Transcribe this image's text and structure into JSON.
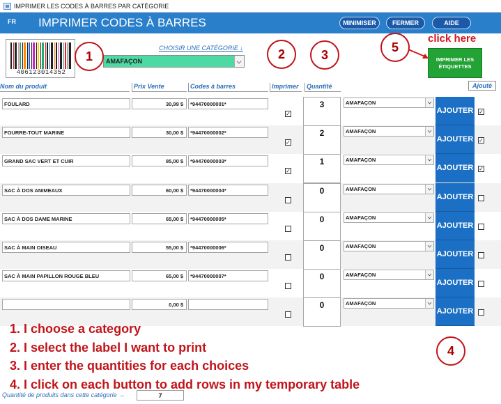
{
  "window": {
    "title": "IMPRIMER LES CODES À BARRES PAR CATÉGORIE"
  },
  "header": {
    "lang": "FR",
    "title": "IMPRIMER CODES À BARRES",
    "buttons": {
      "minimize": "MINIMISER",
      "close": "FERMER",
      "help": "AIDE"
    }
  },
  "barcode": {
    "digits": "406123014352"
  },
  "category": {
    "link_label": "CHOISIR UNE CATÉGORIE ↓",
    "selected": "AMAFAÇON"
  },
  "annotations": {
    "step1": "1",
    "step2": "2",
    "step3": "3",
    "step4": "4",
    "step5": "5",
    "click_here": "click here"
  },
  "print_button": {
    "label": "IMPRIMER LES ÉTIQUETTES"
  },
  "columns": {
    "name": "Nom du produit",
    "price": "Prix Vente",
    "barcode": "Codes à barres",
    "print": "Imprimer",
    "quantity": "Quantité",
    "added": "Ajouté"
  },
  "rows": [
    {
      "name": "FOULARD",
      "price": "30,99 $",
      "barcode": "*94470000001*",
      "print": true,
      "qty": "3",
      "category": "AMAFAÇON",
      "add_label": "AJOUTER",
      "added": true
    },
    {
      "name": "FOURRE-TOUT MARINE",
      "price": "30,00 $",
      "barcode": "*94470000002*",
      "print": true,
      "qty": "2",
      "category": "AMAFAÇON",
      "add_label": "AJOUTER",
      "added": true
    },
    {
      "name": "GRAND SAC VERT ET CUIR",
      "price": "85,00 $",
      "barcode": "*94470000003*",
      "print": true,
      "qty": "1",
      "category": "AMAFAÇON",
      "add_label": "AJOUTER",
      "added": true
    },
    {
      "name": "SAC À DOS ANIMEAUX",
      "price": "60,00 $",
      "barcode": "*94470000004*",
      "print": false,
      "qty": "0",
      "category": "AMAFAÇON",
      "add_label": "AJOUTER",
      "added": false
    },
    {
      "name": "SAC À DOS DAME MARINE",
      "price": "65,00 $",
      "barcode": "*94470000005*",
      "print": false,
      "qty": "0",
      "category": "AMAFAÇON",
      "add_label": "AJOUTER",
      "added": false
    },
    {
      "name": "SAC À MAIN OISEAU",
      "price": "55,00 $",
      "barcode": "*94470000006*",
      "print": false,
      "qty": "0",
      "category": "AMAFAÇON",
      "add_label": "AJOUTER",
      "added": false
    },
    {
      "name": "SAC À MAIN PAPILLON ROUGE BLEU",
      "price": "65,00 $",
      "barcode": "*94470000007*",
      "print": false,
      "qty": "0",
      "category": "AMAFAÇON",
      "add_label": "AJOUTER",
      "added": false
    },
    {
      "name": "",
      "price": "0,00 $",
      "barcode": "",
      "print": false,
      "qty": "0",
      "category": "AMAFAÇON",
      "add_label": "AJOUTER",
      "added": false
    }
  ],
  "instructions": [
    "1. I choose a category",
    "2. I select the label I want to print",
    "3. I enter the quantities for each choices",
    "4. I click on each button to add rows in my temporary table"
  ],
  "footer": {
    "label": "Quantité de produits dans cette catégorie →",
    "count": "7"
  },
  "colors": {
    "header_blue": "#2a7fcb",
    "button_blue": "#1b6fc4",
    "category_green": "#4dd9a3",
    "print_green": "#23a336",
    "annotation_red": "#c1141a"
  }
}
